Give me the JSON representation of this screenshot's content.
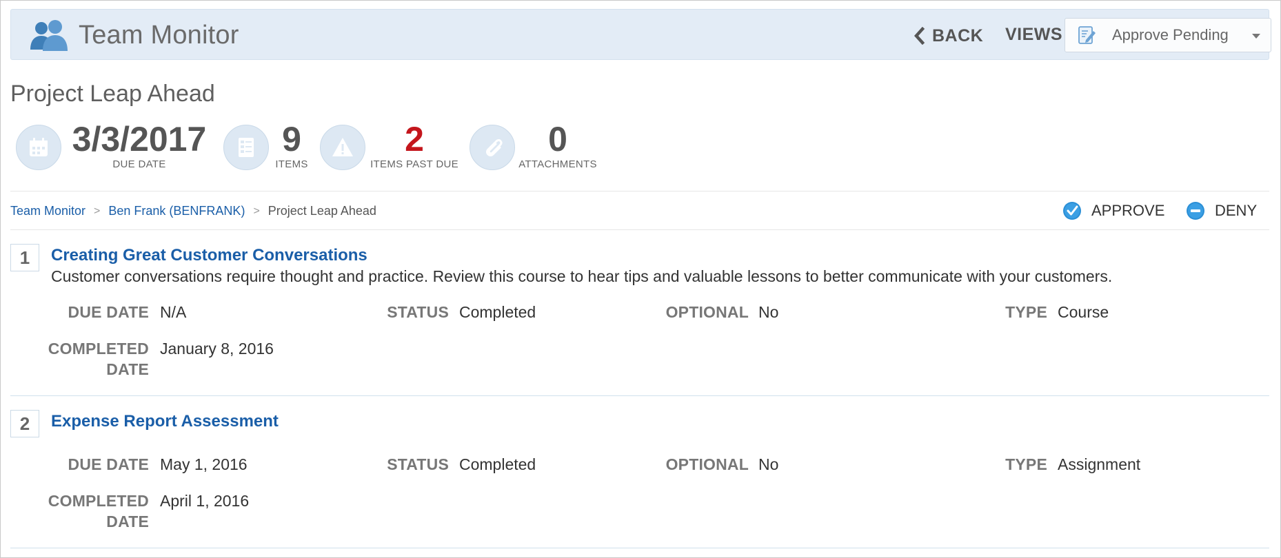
{
  "header": {
    "title": "Team Monitor",
    "back_label": "BACK",
    "views_label": "VIEWS",
    "views_selected": "Approve Pending"
  },
  "project": {
    "title": "Project Leap Ahead",
    "stats": {
      "due_date": {
        "value": "3/3/2017",
        "label": "DUE DATE"
      },
      "items": {
        "value": "9",
        "label": "ITEMS"
      },
      "past_due": {
        "value": "2",
        "label": "ITEMS PAST DUE"
      },
      "attachments": {
        "value": "0",
        "label": "ATTACHMENTS"
      }
    }
  },
  "breadcrumb": {
    "items": [
      "Team Monitor",
      "Ben Frank (BENFRANK)",
      "Project Leap Ahead"
    ],
    "separator": ">"
  },
  "actions": {
    "approve": "APPROVE",
    "deny": "DENY"
  },
  "labels": {
    "due_date": "DUE DATE",
    "status": "STATUS",
    "optional": "OPTIONAL",
    "type": "TYPE",
    "completed_line1": "COMPLETED",
    "completed_line2": "DATE"
  },
  "items": [
    {
      "number": "1",
      "title": "Creating Great Customer Conversations",
      "description": "Customer conversations require thought and practice. Review this course to hear tips and valuable lessons to better communicate with your customers.",
      "due_date": "N/A",
      "status": "Completed",
      "optional": "No",
      "type": "Course",
      "completed_date": "January 8, 2016"
    },
    {
      "number": "2",
      "title": "Expense Report Assessment",
      "description": "",
      "due_date": "May 1, 2016",
      "status": "Completed",
      "optional": "No",
      "type": "Assignment",
      "completed_date": "April 1, 2016"
    }
  ],
  "colors": {
    "header_bg": "#e3ecf6",
    "link": "#1a5ea8",
    "past_due": "#c4161c",
    "approve_icon": "#2b8fd6",
    "deny_icon": "#2b8fd6"
  }
}
